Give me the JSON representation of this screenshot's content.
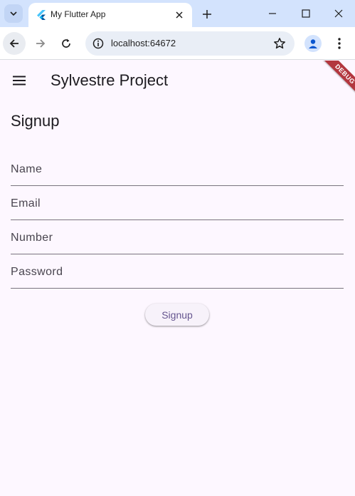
{
  "browser": {
    "tab_title": "My Flutter App",
    "url": "localhost:64672"
  },
  "app": {
    "title": "Sylvestre Project",
    "debug_banner": "DEBUG",
    "heading": "Signup",
    "fields": [
      {
        "label": "Name"
      },
      {
        "label": "Email"
      },
      {
        "label": "Number"
      },
      {
        "label": "Password"
      }
    ],
    "signup_button": "Signup"
  },
  "colors": {
    "background": "#fdf7ff",
    "button_text": "#65558f",
    "debug_ribbon": "#b3373f",
    "tabstrip": "#d3e3fd"
  }
}
